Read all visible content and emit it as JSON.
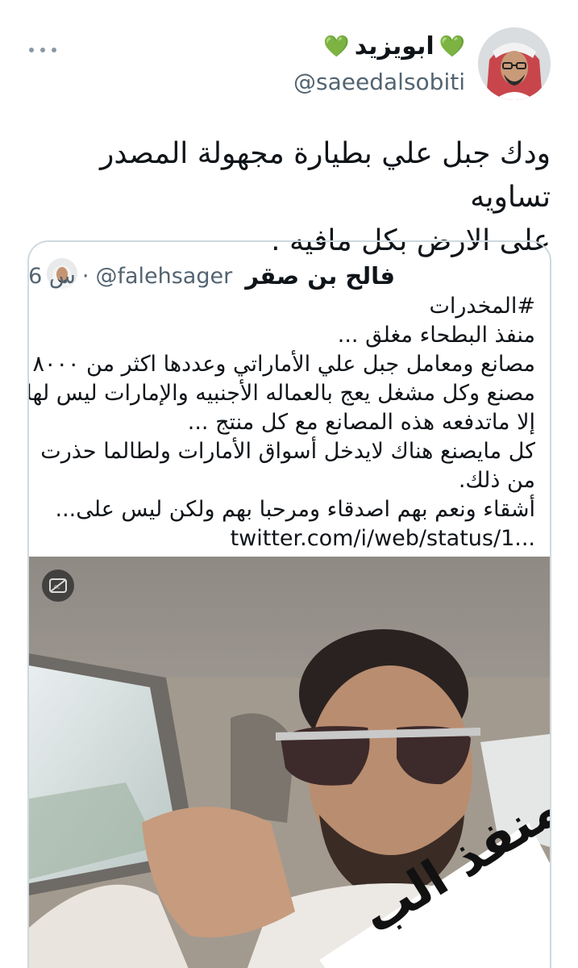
{
  "tweet": {
    "author_name": "ابويزيد",
    "author_heart_left": "💚",
    "author_heart_right": "💚",
    "author_handle": "@saeedalsobiti",
    "text_line1": "ودك جبل علي بطيارة مجهولة المصدر تساويه",
    "text_line2": "على الارض بكل مافيه ."
  },
  "quoted": {
    "name": "فالح بن صقر",
    "handle": "@falehsager",
    "separator": "·",
    "time": "6 س",
    "lines": [
      "#المخدرات",
      "منفذ البطحاء مغلق ...",
      "مصانع ومعامل جبل علي الأماراتي وعددها اكثر من ٨٠٠٠",
      "مصنع وكل مشغل يعج بالعماله الأجنبيه والإمارات ليس لها",
      "إلا ماتدفعه هذه المصانع مع كل منتج ...",
      "كل مايصنع هناك لايدخل أسواق الأمارات ولطالما حذرت",
      "من ذلك.",
      "أشقاء ونعم بهم اصدقاء ومرحبا بهم ولكن ليس على..."
    ],
    "link": "twitter.com/i/web/status/1...",
    "media_sticker_text": "منفذ الب"
  },
  "colors": {
    "secondary_text": "#536471",
    "verified": "#1d9bf0",
    "border": "#cfd9de",
    "heart": "#4cc13d"
  },
  "icons": {
    "more": "more-icon",
    "verified": "verified-badge-icon",
    "captions": "captions-icon"
  }
}
